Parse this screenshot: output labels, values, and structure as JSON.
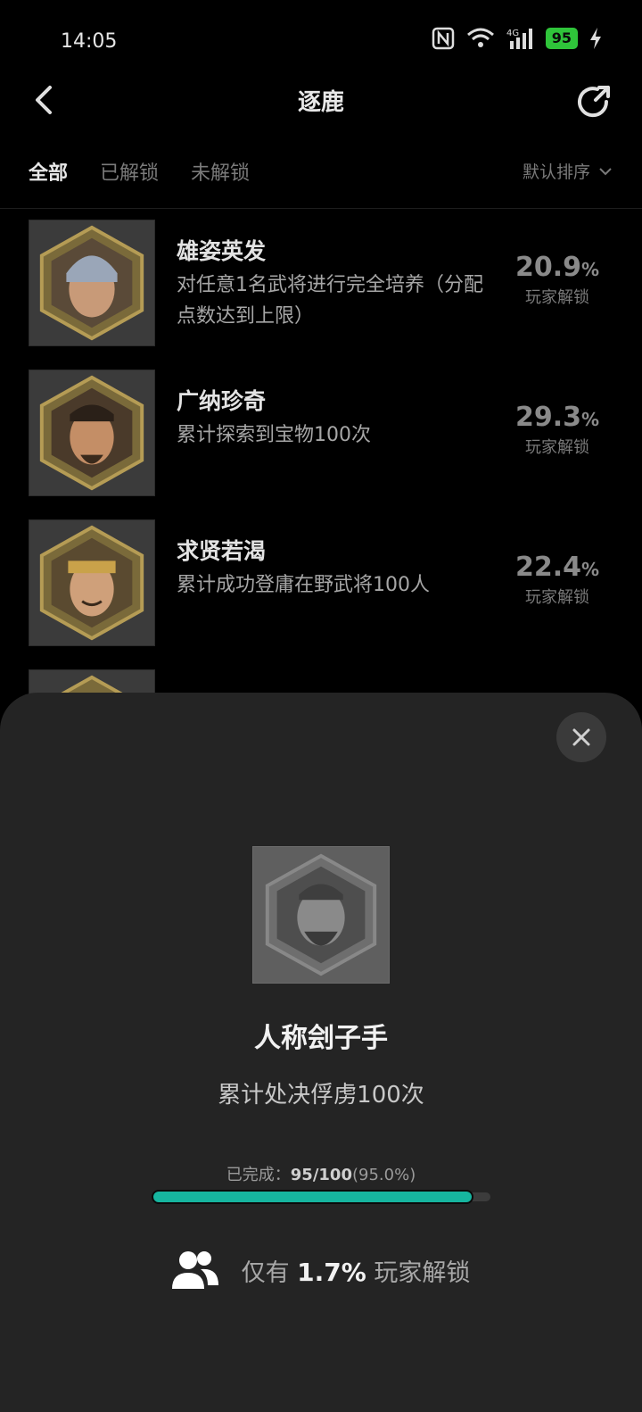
{
  "status_bar": {
    "time": "14:05",
    "battery": "95",
    "network": "4G"
  },
  "nav": {
    "title": "逐鹿"
  },
  "tabs": [
    {
      "label": "全部",
      "active": true
    },
    {
      "label": "已解锁",
      "active": false
    },
    {
      "label": "未解锁",
      "active": false
    }
  ],
  "sort": {
    "label": "默认排序"
  },
  "achievements": [
    {
      "title": "雄姿英发",
      "desc": "对任意1名武将进行完全培养（分配点数达到上限）",
      "percent": "20.9",
      "unit": "%",
      "label": "玩家解锁"
    },
    {
      "title": "广纳珍奇",
      "desc": "累计探索到宝物100次",
      "percent": "29.3",
      "unit": "%",
      "label": "玩家解锁"
    },
    {
      "title": "求贤若渴",
      "desc": "累计成功登庸在野武将100人",
      "percent": "22.4",
      "unit": "%",
      "label": "玩家解锁"
    }
  ],
  "detail": {
    "title": "人称刽子手",
    "desc": "累计处决俘虏100次",
    "progress_label": "已完成：",
    "progress_value": "95/100",
    "progress_pct_text": "(95.0%)",
    "progress_fraction": 0.95,
    "unlock_prefix": "仅有",
    "unlock_pct": "1.7%",
    "unlock_suffix": "玩家解锁"
  },
  "colors": {
    "accent": "#16b59f",
    "battery": "#2fc43a",
    "sheet_bg": "#242424"
  }
}
